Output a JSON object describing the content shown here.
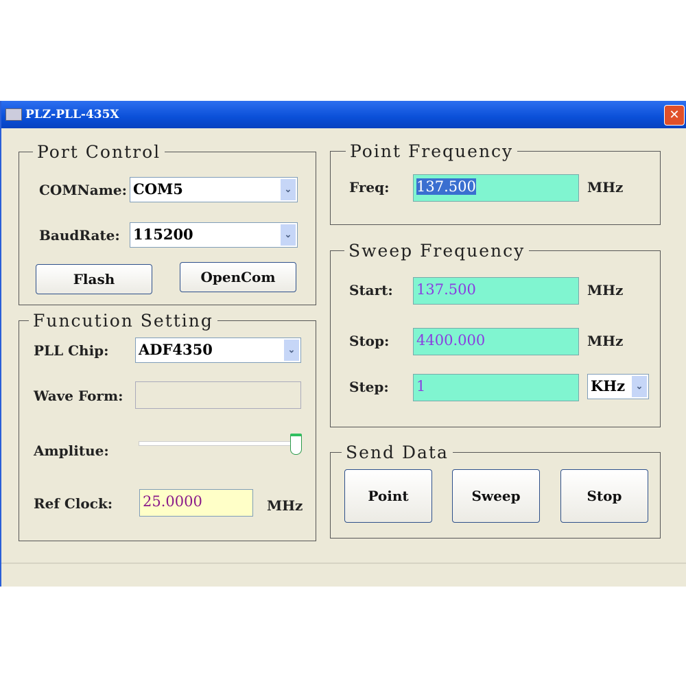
{
  "window": {
    "title": "PLZ-PLL-435X",
    "close": "✕"
  },
  "port_control": {
    "legend": "Port Control",
    "com_label": "COMName:",
    "com_value": "COM5",
    "baud_label": "BaudRate:",
    "baud_value": "115200",
    "flash": "Flash",
    "opencom": "OpenCom"
  },
  "function_setting": {
    "legend": "Funcution Setting",
    "chip_label": "PLL Chip:",
    "chip_value": "ADF4350",
    "wave_label": "Wave Form:",
    "wave_value": "",
    "amp_label": "Amplitue:",
    "amp_value_fraction": 1.0,
    "ref_label": "Ref Clock:",
    "ref_value": "25.0000",
    "ref_unit": "MHz"
  },
  "point_frequency": {
    "legend": "Point Frequency",
    "freq_label": "Freq:",
    "freq_value": "137.500",
    "unit": "MHz"
  },
  "sweep_frequency": {
    "legend": "Sweep Frequency",
    "start_label": "Start:",
    "start_value": "137.500",
    "start_unit": "MHz",
    "stop_label": "Stop:",
    "stop_value": "4400.000",
    "stop_unit": "MHz",
    "step_label": "Step:",
    "step_value": "1",
    "step_unit": "KHz"
  },
  "send_data": {
    "legend": "Send Data",
    "point": "Point",
    "sweep": "Sweep",
    "stop": "Stop"
  },
  "dropdown_arrow": "⌄"
}
